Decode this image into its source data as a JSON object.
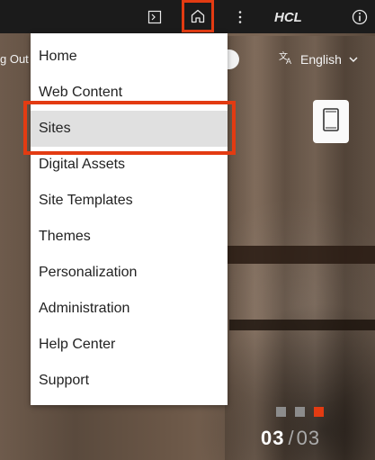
{
  "header": {
    "logo_text": "HCL",
    "icons": [
      "preview-icon",
      "home-icon",
      "kebab-icon",
      "info-icon"
    ],
    "accent_color": "#e33b12"
  },
  "background": {
    "logout_text": "g Out",
    "language_label": "English"
  },
  "menu": {
    "items": [
      {
        "label": "Home"
      },
      {
        "label": "Web Content"
      },
      {
        "label": "Sites",
        "selected": true
      },
      {
        "label": "Digital Assets"
      },
      {
        "label": "Site Templates"
      },
      {
        "label": "Themes"
      },
      {
        "label": "Personalization"
      },
      {
        "label": "Administration"
      },
      {
        "label": "Help Center"
      },
      {
        "label": "Support"
      }
    ]
  },
  "pager": {
    "current": "03",
    "separator": "/",
    "total": "03"
  }
}
